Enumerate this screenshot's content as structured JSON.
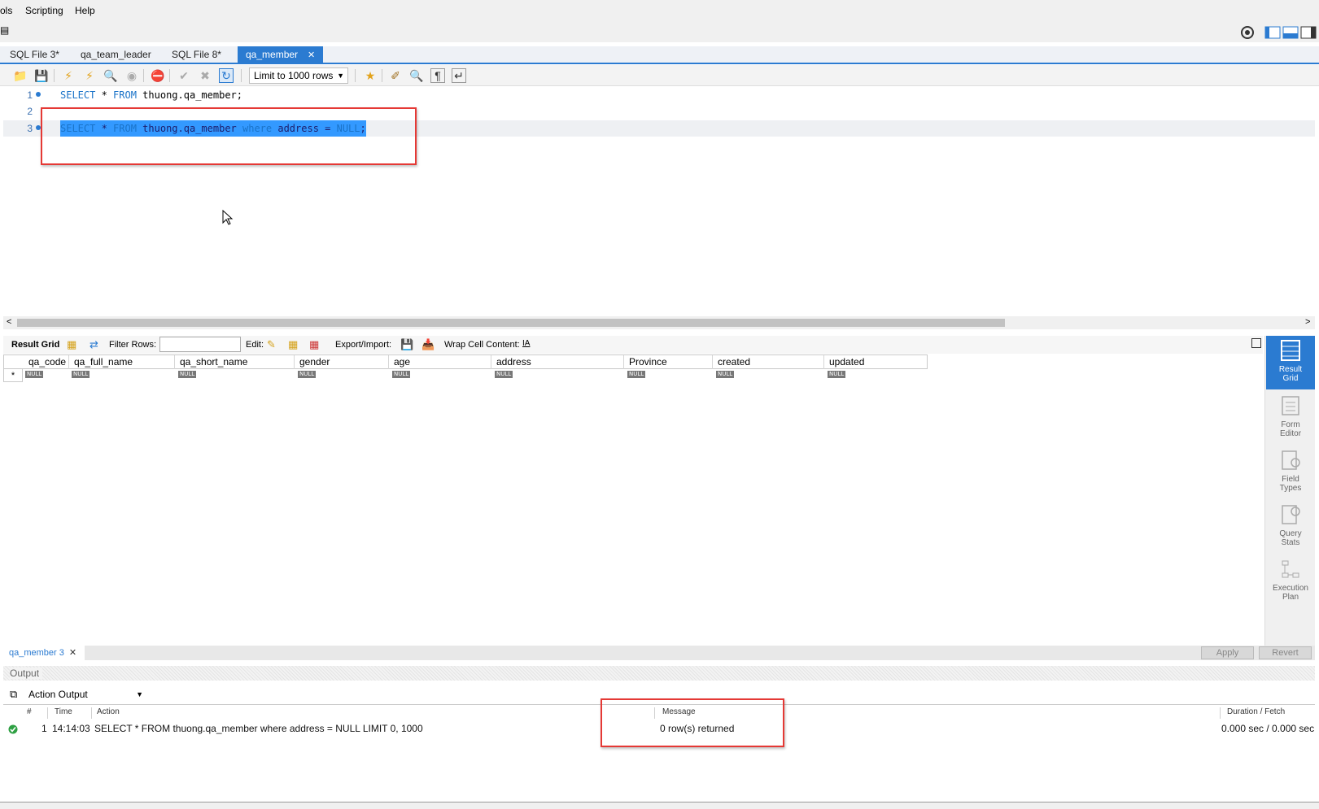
{
  "menu": {
    "items": [
      "ols",
      "Scripting",
      "Help"
    ]
  },
  "tabs": [
    {
      "label": "SQL File 3*"
    },
    {
      "label": "qa_team_leader"
    },
    {
      "label": "SQL File 8*"
    },
    {
      "label": "qa_member",
      "active": true
    }
  ],
  "toolbar": {
    "limit_label": "Limit to 1000 rows"
  },
  "editor": {
    "lines": [
      {
        "num": "1",
        "kw1": "SELECT",
        "t1": " * ",
        "kw2": "FROM",
        "t2": " thuong.qa_member;"
      },
      {
        "num": "2"
      },
      {
        "num": "3",
        "kw1": "SELECT",
        "t1": " * ",
        "kw2": "FROM",
        "t2": " thuong.qa_member ",
        "kw3": "where",
        "t3": " address = ",
        "kw4": "NULL",
        "t4": ";"
      }
    ]
  },
  "result_toolbar": {
    "result_grid": "Result Grid",
    "filter_rows": "Filter Rows:",
    "edit": "Edit:",
    "export_import": "Export/Import:",
    "wrap": "Wrap Cell Content:"
  },
  "grid": {
    "columns": [
      "qa_code",
      "qa_full_name",
      "qa_short_name",
      "gender",
      "age",
      "address",
      "Province",
      "created",
      "updated"
    ],
    "null_label": "NULL",
    "row_marker": "*"
  },
  "side_panel": [
    {
      "line1": "Result",
      "line2": "Grid",
      "icon": "result-grid-icon",
      "active": true
    },
    {
      "line1": "Form",
      "line2": "Editor",
      "icon": "form-editor-icon"
    },
    {
      "line1": "Field",
      "line2": "Types",
      "icon": "field-types-icon"
    },
    {
      "line1": "Query",
      "line2": "Stats",
      "icon": "query-stats-icon"
    },
    {
      "line1": "Execution",
      "line2": "Plan",
      "icon": "execution-plan-icon"
    }
  ],
  "result_tab": {
    "label": "qa_member 3",
    "apply": "Apply",
    "revert": "Revert"
  },
  "output": {
    "header": "Output",
    "selector": "Action Output",
    "columns": {
      "num": "#",
      "time": "Time",
      "action": "Action",
      "message": "Message",
      "duration": "Duration / Fetch"
    },
    "rows": [
      {
        "num": "1",
        "time": "14:14:03",
        "action": "SELECT * FROM thuong.qa_member where address = NULL LIMIT 0, 1000",
        "message": "0 row(s) returned",
        "duration": "0.000 sec / 0.000 sec",
        "status": "success"
      }
    ]
  },
  "colors": {
    "accent": "#2b7bd1",
    "highlight_box": "#e53935",
    "selection": "#3399ff",
    "keyword": "#1a73c8"
  }
}
